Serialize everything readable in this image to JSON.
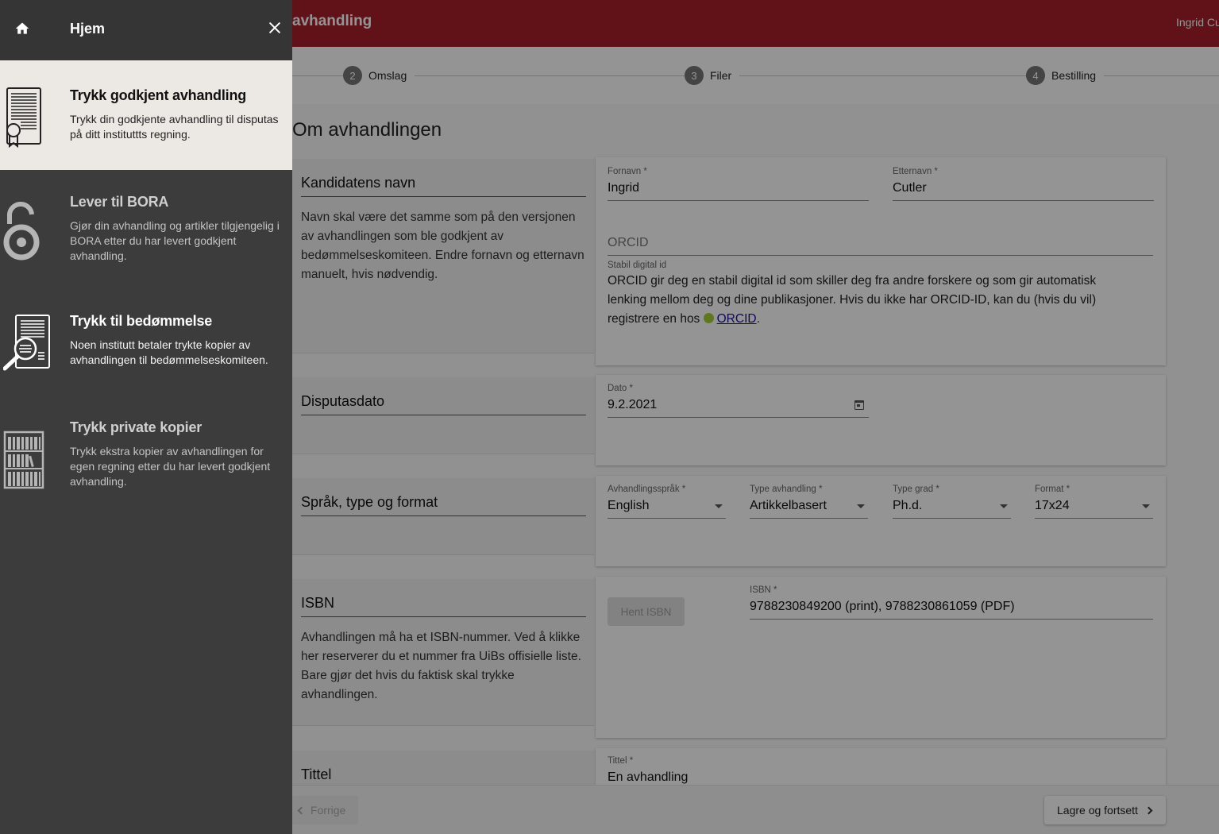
{
  "app": {
    "header_title": "avhandling",
    "user_name": "Ingrid Cutler",
    "brand_color": "#a8202a"
  },
  "stepper": {
    "steps": [
      {
        "num": "2",
        "label": "Omslag"
      },
      {
        "num": "3",
        "label": "Filer"
      },
      {
        "num": "4",
        "label": "Bestilling"
      }
    ]
  },
  "page": {
    "heading": "Om avhandlingen"
  },
  "sections": {
    "kandidat": {
      "title": "Kandidatens navn",
      "text": "Navn skal være det samme som på den versjonen av avhandlingen som ble godkjent av bedømmelseskomiteen. Endre fornavn og etternavn manuelt, hvis nødvendig.",
      "fornavn_label": "Fornavn *",
      "fornavn_value": "Ingrid",
      "etternavn_label": "Etternavn *",
      "etternavn_value": "Cutler",
      "orcid_placeholder": "ORCID",
      "orcid_hint_label": "Stabil digital id",
      "orcid_hint_text": "ORCID gir deg en stabil digital id som skiller deg fra andre forskere og som gir automatisk lenking mellom deg og dine publikasjoner. Hvis du ikke har ORCID-ID, kan du (hvis du vil) registrere en hos",
      "orcid_link": "ORCID",
      "orcid_color": "#a6ce39"
    },
    "disputas": {
      "title": "Disputasdato",
      "dato_label": "Dato *",
      "dato_value": "9.2.2021"
    },
    "sprak": {
      "title": "Språk, type og format",
      "fields": [
        {
          "label": "Avhandlingsspråk *",
          "value": "English"
        },
        {
          "label": "Type avhandling *",
          "value": "Artikkelbasert"
        },
        {
          "label": "Type grad *",
          "value": "Ph.d."
        },
        {
          "label": "Format *",
          "value": "17x24"
        }
      ]
    },
    "isbn": {
      "title": "ISBN",
      "text": "Avhandlingen må ha et ISBN-nummer. Ved å klikke her reserverer du et nummer fra UiBs offisielle liste. Bare gjør det hvis du faktisk skal trykke avhandlingen.",
      "button_label": "Hent ISBN",
      "isbn_label": "ISBN *",
      "isbn_value": "9788230849200 (print), 9788230861059 (PDF)"
    },
    "tittel": {
      "title": "Tittel",
      "tittel_label": "Tittel *",
      "tittel_value": "En avhandling"
    }
  },
  "footer": {
    "prev_label": "Forrige",
    "next_label": "Lagre og fortsett"
  },
  "drawer": {
    "title": "Hjem",
    "items": [
      {
        "title": "Trykk godkjent avhandling",
        "text": "Trykk din godkjente avhandling til disputas på ditt instituttts regning.",
        "icon": "document-certificate-icon"
      },
      {
        "title": "Lever til BORA",
        "text": "Gjør din avhandling og artikler tilgjengelig i BORA etter du har levert godkjent avhandling.",
        "icon": "open-access-lock-icon"
      },
      {
        "title": "Trykk til bedømmelse",
        "text": "Noen institutt betaler trykte kopier av avhandlingen til bedømmelseskomiteen.",
        "icon": "document-magnifier-icon"
      },
      {
        "title": "Trykk private kopier",
        "text": "Trykk ekstra kopier av avhandlingen for egen regning etter du har levert godkjent avhandling.",
        "icon": "bookshelf-icon"
      }
    ]
  }
}
